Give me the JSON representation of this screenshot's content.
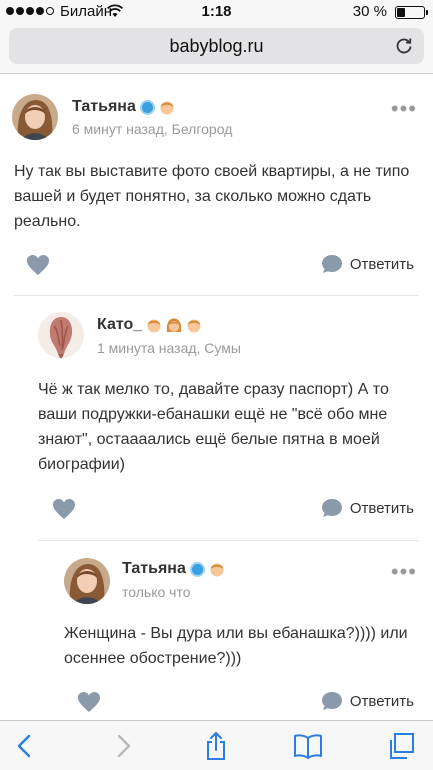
{
  "status_bar": {
    "carrier": "Билайн",
    "time": "1:18",
    "battery_pct": "30 %",
    "battery_level": 0.3
  },
  "browser": {
    "url": "babyblog.ru"
  },
  "comments": [
    {
      "author": "Татьяна",
      "meta": "6 минут назад, Белгород",
      "text": "Ну так вы выставите фото своей квартиры, а не типо вашей и будет понятно, за сколько можно сдать реально.",
      "reply_label": "Ответить",
      "badges": [
        "verified",
        "boy"
      ]
    },
    {
      "author": "Като_",
      "meta": "1 минута назад, Сумы",
      "text": "Чё ж так мелко то, давайте сразу паспорт) А то ваши подружки-ебанашки ещё не \"всё обо мне знают\", остаааались ещё белые пятна в моей биографии)",
      "reply_label": "Ответить",
      "badges": [
        "boy",
        "girl",
        "boy"
      ]
    },
    {
      "author": "Татьяна",
      "meta": "только что",
      "text": "Женщина - Вы дура или вы ебанашка?)))) или осеннее обострение?)))",
      "reply_label": "Ответить",
      "badges": [
        "verified",
        "boy"
      ]
    }
  ],
  "icons": {
    "more": "more-dots-icon",
    "like": "heart-icon",
    "reply": "speech-bubble-icon",
    "back": "back-arrow-icon",
    "forward": "forward-arrow-icon",
    "share": "share-icon",
    "bookmarks": "book-icon",
    "tabs": "tabs-icon"
  },
  "colors": {
    "accent_blue": "#3a9fe0",
    "icon_gray": "#8a9aab",
    "meta_gray": "#9a9a9a",
    "toolbar_icon": "#2a7de1"
  }
}
